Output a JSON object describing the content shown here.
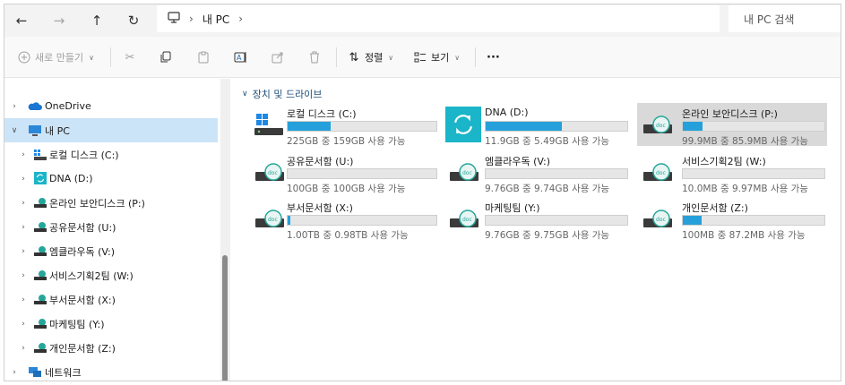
{
  "address_bar": {
    "back_icon": "arrow-left-icon",
    "forward_icon": "arrow-right-icon",
    "up_icon": "arrow-up-icon",
    "refresh_icon": "refresh-icon",
    "location_icon": "computer-icon",
    "path": "내 PC",
    "search_placeholder": "내 PC 검색"
  },
  "toolbar": {
    "new_label": "새로 만들기",
    "sort_label": "정렬",
    "view_label": "보기",
    "more_label": "···"
  },
  "sidebar": {
    "items": [
      {
        "label": "OneDrive"
      },
      {
        "label": "내 PC"
      },
      {
        "label": "로컬 디스크 (C:)"
      },
      {
        "label": "DNA (D:)"
      },
      {
        "label": "온라인 보안디스크 (P:)"
      },
      {
        "label": "공유문서함 (U:)"
      },
      {
        "label": "엠클라우독 (V:)"
      },
      {
        "label": "서비스기획2팀 (W:)"
      },
      {
        "label": "부서문서함 (X:)"
      },
      {
        "label": "마케팅팀 (Y:)"
      },
      {
        "label": "개인문서함 (Z:)"
      },
      {
        "label": "네트워크"
      }
    ]
  },
  "main": {
    "group_label": "장치 및 드라이브",
    "drives": [
      {
        "name": "로컬 디스크 (C:)",
        "size_text": "225GB 중 159GB 사용 가능",
        "used_fraction": 0.29,
        "icon": "windows-drive-icon"
      },
      {
        "name": "DNA (D:)",
        "size_text": "11.9GB 중 5.49GB 사용 가능",
        "used_fraction": 0.54,
        "icon": "sync-drive-icon"
      },
      {
        "name": "온라인 보안디스크 (P:)",
        "size_text": "99.9MB 중 85.9MB 사용 가능",
        "used_fraction": 0.14,
        "icon": "network-drive-icon"
      },
      {
        "name": "공유문서함 (U:)",
        "size_text": "100GB 중 100GB 사용 가능",
        "used_fraction": 0.0,
        "icon": "network-drive-icon"
      },
      {
        "name": "엠클라우독 (V:)",
        "size_text": "9.76GB 중 9.74GB 사용 가능",
        "used_fraction": 0.0,
        "icon": "network-drive-icon"
      },
      {
        "name": "서비스기획2팀 (W:)",
        "size_text": "10.0MB 중 9.97MB 사용 가능",
        "used_fraction": 0.0,
        "icon": "network-drive-icon"
      },
      {
        "name": "부서문서함 (X:)",
        "size_text": "1.00TB 중 0.98TB 사용 가능",
        "used_fraction": 0.02,
        "icon": "network-drive-icon"
      },
      {
        "name": "마케팅팀 (Y:)",
        "size_text": "9.76GB 중 9.75GB 사용 가능",
        "used_fraction": 0.0,
        "icon": "network-drive-icon"
      },
      {
        "name": "개인문서함 (Z:)",
        "size_text": "100MB 중 87.2MB 사용 가능",
        "used_fraction": 0.13,
        "icon": "network-drive-icon"
      }
    ]
  },
  "colors": {
    "accent": "#26a0da",
    "selection": "#cce4f7",
    "highlight": "#d9d9d9",
    "group_header": "#1f4e79"
  }
}
